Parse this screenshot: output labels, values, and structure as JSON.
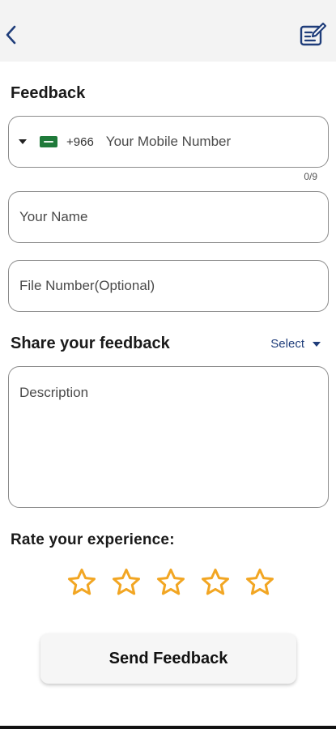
{
  "header": {
    "back_icon": "chevron-left-icon",
    "action_icon": "edit-note-icon"
  },
  "page": {
    "title": "Feedback"
  },
  "form": {
    "phone": {
      "dial_code": "+966",
      "placeholder": "Your Mobile Number",
      "counter": "0/9",
      "flag_icon": "saudi-flag-icon"
    },
    "name": {
      "placeholder": "Your Name"
    },
    "file_number": {
      "placeholder": "File Number(Optional)"
    },
    "feedback": {
      "title": "Share your feedback",
      "select_label": "Select",
      "description_placeholder": "Description"
    },
    "rating": {
      "title": "Rate your experience:",
      "max": 5,
      "value": 0
    }
  },
  "actions": {
    "send_label": "Send Feedback"
  },
  "colors": {
    "accent_navy": "#1f3d7a",
    "star_outline": "#f2a623",
    "topbar_bg": "#f3f3f3",
    "border": "#8c8c8c"
  }
}
